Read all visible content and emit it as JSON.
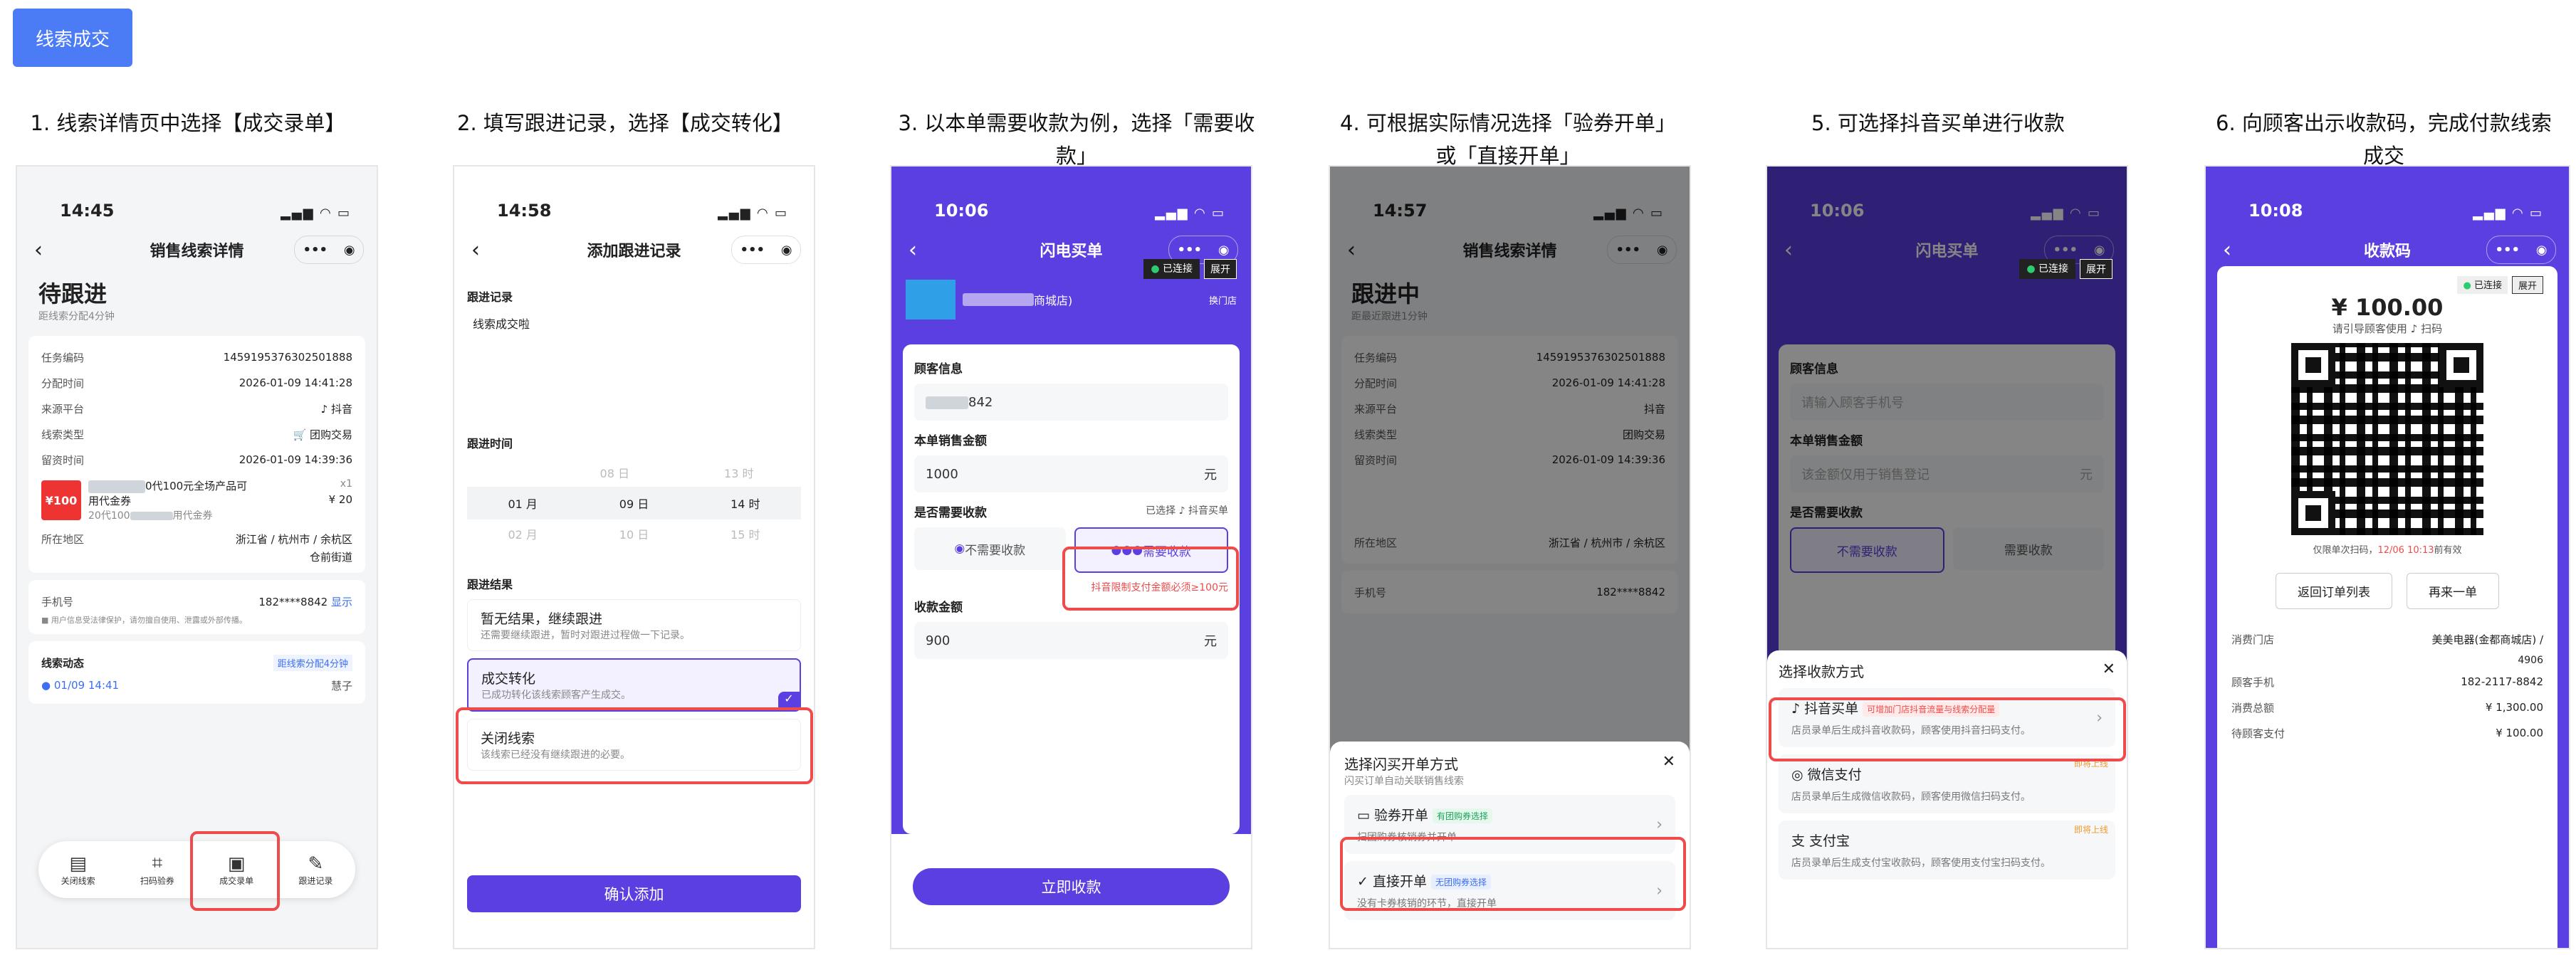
{
  "top_button": "线索成交",
  "steps": [
    {
      "title": "1. 线索详情页中选择【成交录单】"
    },
    {
      "title": "2. 填写跟进记录，选择【成交转化】"
    },
    {
      "title": "3. 以本单需要收款为例，选择「需要收款」"
    },
    {
      "title": "4. 可根据实际情况选择「验券开单」或「直接开单」"
    },
    {
      "title": "5. 可选择抖音买单进行收款"
    },
    {
      "title": "6. 向顾客出示收款码，完成付款线索成交"
    }
  ],
  "p1": {
    "time": "14:45",
    "nav_title": "销售线索详情",
    "status": "待跟进",
    "status_sub": "距线索分配4分钟",
    "rows": [
      {
        "k": "任务编码",
        "v": "1459195376302501888"
      },
      {
        "k": "分配时间",
        "v": "2026-01-09 14:41:28"
      },
      {
        "k": "来源平台",
        "v": "抖音"
      },
      {
        "k": "线索类型",
        "v": "团购交易"
      },
      {
        "k": "留资时间",
        "v": "2026-01-09 14:39:36"
      }
    ],
    "product_name": "0代100元全场产品可",
    "product_qty": "x1",
    "product_sub": "用代金券",
    "product_price": "¥ 20",
    "product_note": "20代100",
    "product_note2": "用代金券",
    "region_label": "所在地区",
    "region": "浙江省 / 杭州市 / 余杭区",
    "region2": "仓前街道",
    "phone_label": "手机号",
    "phone": "182****8842",
    "show": "显示",
    "privacy": "用户信息受法律保护，请勿擅自使用、泄露或外部传播。",
    "dyn_title": "线索动态",
    "dyn_tag": "距线索分配4分钟",
    "dyn_time": "01/09 14:41",
    "dyn_who": "慧子",
    "tabs": [
      "关闭线索",
      "扫码验券",
      "成交录单",
      "跟进记录"
    ]
  },
  "p2": {
    "time": "14:58",
    "nav_title": "添加跟进记录",
    "record_label": "跟进记录",
    "record_value": "线索成交啦",
    "time_label": "跟进时间",
    "picker": [
      [
        "08 日",
        "13 时"
      ],
      [
        "01 月",
        "09 日",
        "14 时"
      ],
      [
        "02 月",
        "10 日",
        "15 时"
      ]
    ],
    "result_label": "跟进结果",
    "options": [
      {
        "t": "暂无结果，继续跟进",
        "d": "还需要继续跟进，暂时对跟进过程做一下记录。"
      },
      {
        "t": "成交转化",
        "d": "已成功转化该线索顾客产生成交。"
      },
      {
        "t": "关闭线索",
        "d": "该线索已经没有继续跟进的必要。"
      }
    ],
    "confirm": "确认添加"
  },
  "p3": {
    "time": "10:06",
    "nav_title": "闪电买单",
    "connected": "已连接",
    "expand": "展开",
    "store_suffix": "商城店)",
    "switch_store": "换门店",
    "customer_label": "顾客信息",
    "phone_tail": "842",
    "amount_label": "本单销售金额",
    "amount": "1000",
    "unit": "元",
    "need_label": "是否需要收款",
    "selected_hint": "已选择",
    "dy_pay": "抖音买单",
    "no_need": "不需要收款",
    "need": "需要收款",
    "limit_tip": "抖音限制支付金额必须≥100元",
    "collect_label": "收款金额",
    "collect": "900",
    "submit": "立即收款"
  },
  "p4": {
    "time": "14:57",
    "nav_title": "销售线索详情",
    "status": "跟进中",
    "status_sub": "距最近跟进1分钟",
    "sheet_title": "选择闪买开单方式",
    "sheet_sub": "闪买订单自动关联销售线索",
    "opt1": "验券开单",
    "opt1_tag": "有团购券选择",
    "opt1_d": "扫团购券核销券并开单",
    "opt2": "直接开单",
    "opt2_tag": "无团购券选择",
    "opt2_d": "没有卡券核销的环节，直接开单"
  },
  "p5": {
    "time": "10:06",
    "nav_title": "闪电买单",
    "connected": "已连接",
    "expand": "展开",
    "customer_label": "顾客信息",
    "phone_ph": "请输入顾客手机号",
    "amount_label": "本单销售金额",
    "amount_ph": "该金额仅用于销售登记",
    "unit": "元",
    "need_label": "是否需要收款",
    "no_need": "不需要收款",
    "need": "需要收款",
    "sheet_title": "选择收款方式",
    "m1": "抖音买单",
    "m1_tag": "可增加门店抖音流量与线索分配量",
    "m1_d": "店员录单后生成抖音收款码，顾客使用抖音扫码支付。",
    "m2": "微信支付",
    "m2_tag": "即将上线",
    "m2_d": "店员录单后生成微信收款码，顾客使用微信扫码支付。",
    "m3": "支付宝",
    "m3_tag": "即将上线",
    "m3_d": "店员录单后生成支付宝收款码，顾客使用支付宝扫码支付。"
  },
  "p6": {
    "time": "10:08",
    "nav_title": "收款码",
    "connected": "已连接",
    "expand": "展开",
    "amount": "¥ 100.00",
    "hint": "请引导顾客使用",
    "scan": "扫码",
    "valid": "仅限单次扫码，",
    "valid_time": "12/06 10:13",
    "valid_end": "前有效",
    "back_btn": "返回订单列表",
    "again_btn": "再来一单",
    "rows": [
      {
        "k": "消费门店",
        "v": "美美电器(金都商城店) /"
      },
      {
        "k": "",
        "v": "4906"
      },
      {
        "k": "顾客手机",
        "v": "182-2117-8842"
      },
      {
        "k": "消费总额",
        "v": "¥ 1,300.00"
      },
      {
        "k": "待顾客支付",
        "v": "¥ 100.00"
      }
    ]
  }
}
